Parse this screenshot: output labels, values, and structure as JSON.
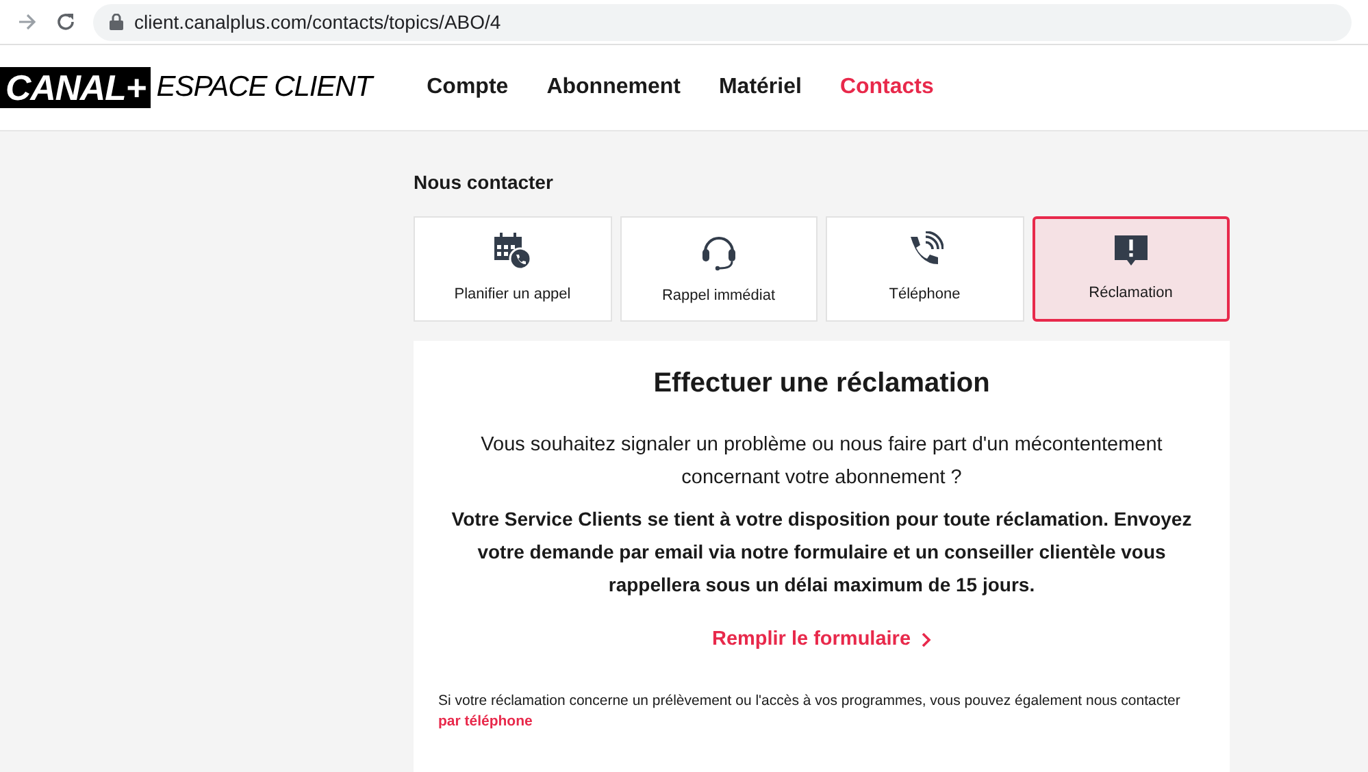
{
  "browser": {
    "url": "client.canalplus.com/contacts/topics/ABO/4"
  },
  "header": {
    "logo": "CANAL+",
    "logo_suffix": "ESPACE CLIENT",
    "nav": [
      {
        "label": "Compte",
        "selected": false
      },
      {
        "label": "Abonnement",
        "selected": false
      },
      {
        "label": "Matériel",
        "selected": false
      },
      {
        "label": "Contacts",
        "selected": true
      }
    ]
  },
  "section_title": "Nous contacter",
  "tiles": [
    {
      "label": "Planifier un appel",
      "kind": "calendar",
      "selected": false
    },
    {
      "label": "Rappel immédiat",
      "kind": "headset",
      "selected": false
    },
    {
      "label": "Téléphone",
      "kind": "phone",
      "selected": false
    },
    {
      "label": "Réclamation",
      "kind": "alert",
      "selected": true
    }
  ],
  "card": {
    "title": "Effectuer une réclamation",
    "intro": "Vous souhaitez signaler un problème ou nous faire part d'un mécontentement concernant votre abonnement ?",
    "body": "Votre Service Clients se tient à votre disposition pour toute réclamation. Envoyez votre demande par email via notre formulaire et un conseiller clientèle vous rappellera sous un délai maximum de 15 jours.",
    "action": "Remplir le formulaire",
    "note": "Si votre réclamation concerne un prélèvement ou l'accès à vos programmes, vous pouvez également nous contacter",
    "note_link": "par téléphone"
  }
}
